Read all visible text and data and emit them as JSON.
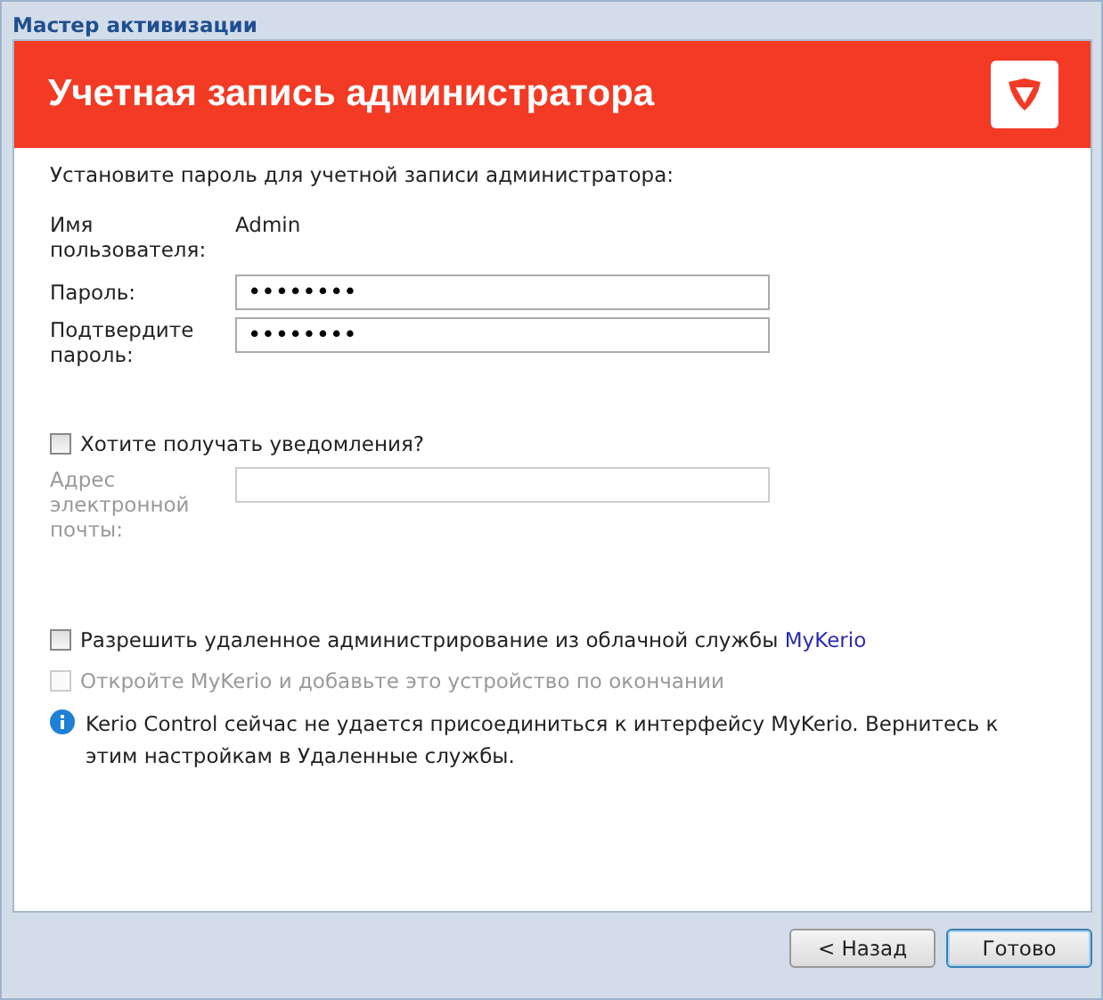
{
  "window": {
    "title": "Мастер активизации"
  },
  "header": {
    "title": "Учетная запись администратора"
  },
  "intro": "Установите пароль для учетной записи администратора:",
  "username": {
    "label": "Имя пользователя:",
    "value": "Admin"
  },
  "password": {
    "label": "Пароль:",
    "value": "••••••••"
  },
  "confirm": {
    "label": "Подтвердите пароль:",
    "value": "••••••••"
  },
  "notifications": {
    "label": "Хотите получать уведомления?",
    "checked": false,
    "disabled": false
  },
  "email": {
    "label": "Адрес электронной почты:",
    "disabled": true
  },
  "remote_admin": {
    "label": "Разрешить удаленное администрирование из облачной службы",
    "link": "MyKerio",
    "checked": false,
    "disabled": false
  },
  "open_mykerio": {
    "label": "Откройте MyKerio и добавьте это устройство по окончании",
    "checked": false,
    "disabled": true
  },
  "info": "Kerio Control сейчас не удается присоединиться к интерфейсу MyKerio. Вернитесь к этим настройкам в Удаленные службы.",
  "buttons": [
    {
      "label": "< Назад",
      "selected": false
    },
    {
      "label": "Готово",
      "selected": true
    }
  ]
}
